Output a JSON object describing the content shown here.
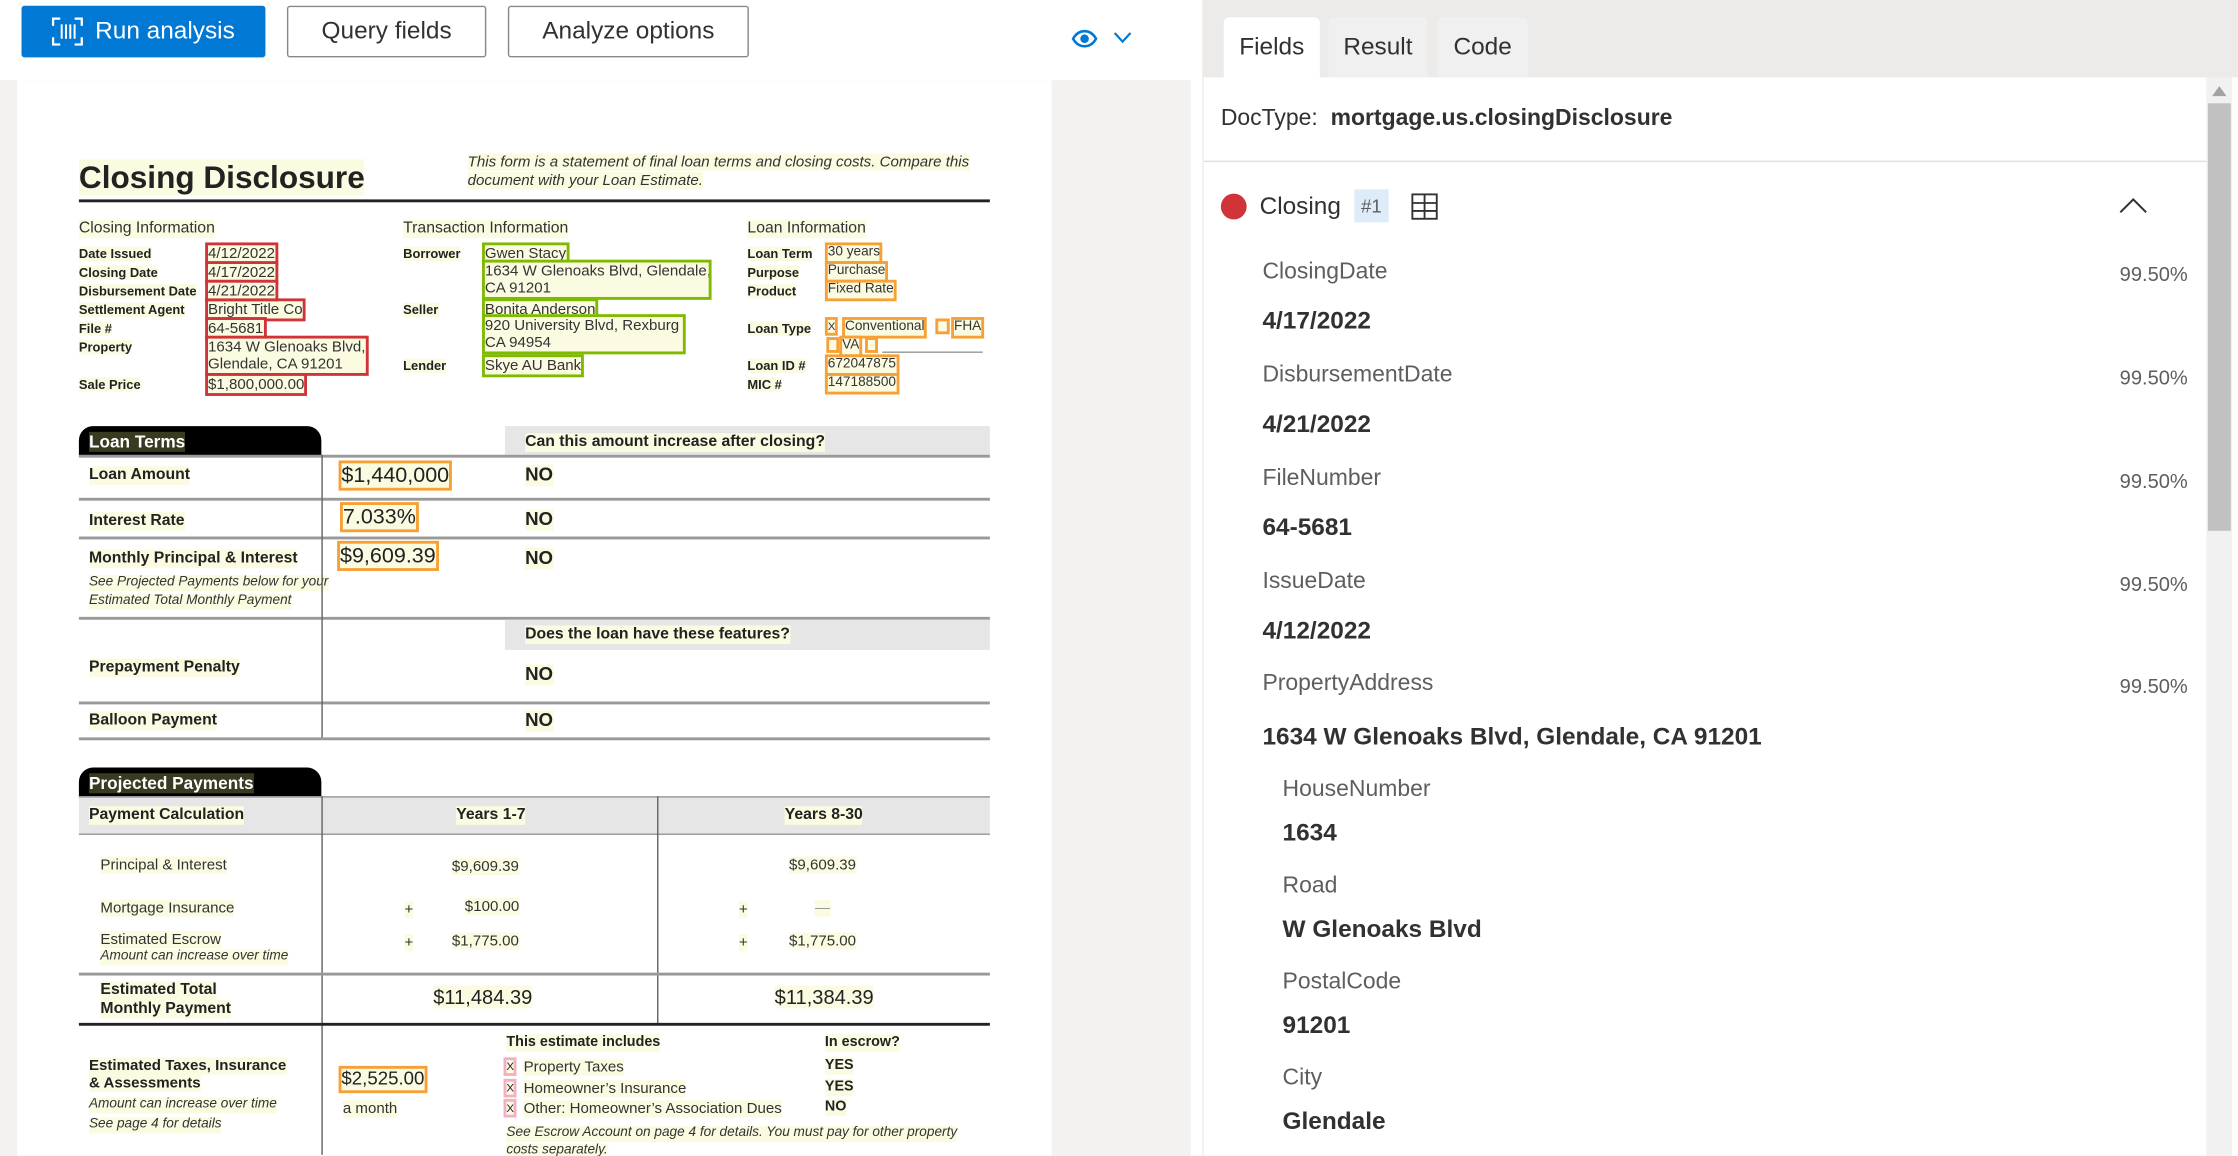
{
  "toolbar": {
    "run_label": "Run analysis",
    "query_label": "Query fields",
    "options_label": "Analyze options",
    "accent": "#0078d4"
  },
  "document": {
    "title": "Closing Disclosure",
    "note1": "This form is a statement of final loan terms and closing costs. Compare this",
    "note2": "document with your Loan Estimate.",
    "closing_info": {
      "header": "Closing Information",
      "rows": [
        {
          "label": "Date Issued",
          "value": "4/12/2022"
        },
        {
          "label": "Closing Date",
          "value": "4/17/2022"
        },
        {
          "label": "Disbursement Date",
          "value": "4/21/2022"
        },
        {
          "label": "Settlement Agent",
          "value": "Bright Title Co"
        },
        {
          "label": "File #",
          "value": "64-5681"
        },
        {
          "label": "Property",
          "value": "1634 W Glenoaks Blvd,",
          "value2": "Glendale, CA 91201"
        },
        {
          "label": "Sale Price",
          "value": "$1,800,000.00"
        }
      ]
    },
    "transaction_info": {
      "header": "Transaction Information",
      "borrower_label": "Borrower",
      "borrower": "Gwen Stacy",
      "borrower_addr1": "1634 W Glenoaks Blvd, Glendale,",
      "borrower_addr2": "CA 91201",
      "seller_label": "Seller",
      "seller": "Bonita Anderson",
      "seller_addr1": "920 University Blvd, Rexburg",
      "seller_addr2": "CA 94954",
      "lender_label": "Lender",
      "lender": "Skye AU Bank"
    },
    "loan_info": {
      "header": "Loan Information",
      "term_label": "Loan Term",
      "term": "30 years",
      "purpose_label": "Purpose",
      "purpose": "Purchase",
      "product_label": "Product",
      "product": "Fixed Rate",
      "type_label": "Loan Type",
      "type_conv": "Conventional",
      "type_fha": "FHA",
      "type_va": "VA",
      "check_x": "X",
      "id_label": "Loan ID #",
      "id": "672047875",
      "mic_label": "MIC #",
      "mic": "147188500"
    },
    "loan_terms": {
      "tab": "Loan Terms",
      "question1": "Can this amount increase after closing?",
      "question2": "Does the loan have these features?",
      "rows": [
        {
          "label": "Loan Amount",
          "value": "$1,440,000",
          "answer": "NO"
        },
        {
          "label": "Interest Rate",
          "value": "7.033%",
          "answer": "NO"
        },
        {
          "label": "Monthly Principal & Interest",
          "value": "$9,609.39",
          "answer": "NO",
          "note1": "See Projected Payments below for your",
          "note2": "Estimated Total Monthly Payment"
        },
        {
          "label": "Prepayment Penalty",
          "answer": "NO"
        },
        {
          "label": "Balloon Payment",
          "answer": "NO"
        }
      ]
    },
    "projected": {
      "tab": "Projected Payments",
      "col0": "Payment Calculation",
      "col1": "Years 1-7",
      "col2": "Years 8-30",
      "pi_label": "Principal & Interest",
      "pi1": "$9,609.39",
      "pi2": "$9,609.39",
      "mi_label": "Mortgage Insurance",
      "mi1": "$100.00",
      "mi2": "—",
      "plus": "+",
      "esc_label": "Estimated Escrow",
      "esc_note": "Amount can increase over time",
      "esc1": "$1,775.00",
      "esc2": "$1,775.00",
      "total_label1": "Estimated Total",
      "total_label2": "Monthly Payment",
      "total1": "$11,484.39",
      "total2": "$11,384.39",
      "tax_label1": "Estimated Taxes, Insurance",
      "tax_label2": "& Assessments",
      "tax_note1": "Amount can increase over time",
      "tax_note2": "See page 4 for details",
      "tax_value": "$2,525.00",
      "tax_period": "a month",
      "includes_header": "This estimate includes",
      "escrow_header": "In escrow?",
      "includes": [
        {
          "item": "Property Taxes",
          "escrow": "YES"
        },
        {
          "item": "Homeowner’s Insurance",
          "escrow": "YES"
        },
        {
          "item": "Other: Homeowner’s Association Dues",
          "escrow": "NO"
        }
      ],
      "footnote1": "See Escrow Account on page 4 for details. You must pay for other property",
      "footnote2": "costs separately."
    }
  },
  "panel": {
    "tabs": [
      "Fields",
      "Result",
      "Code"
    ],
    "doctype_label": "DocType:",
    "doctype": "mortgage.us.closingDisclosure",
    "group": {
      "name": "Closing",
      "badge": "#1",
      "color": "#d13438"
    },
    "fields": [
      {
        "name": "ClosingDate",
        "value": "4/17/2022",
        "confidence": "99.50%"
      },
      {
        "name": "DisbursementDate",
        "value": "4/21/2022",
        "confidence": "99.50%"
      },
      {
        "name": "FileNumber",
        "value": "64-5681",
        "confidence": "99.50%"
      },
      {
        "name": "IssueDate",
        "value": "4/12/2022",
        "confidence": "99.50%"
      },
      {
        "name": "PropertyAddress",
        "value": "1634 W Glenoaks Blvd, Glendale, CA 91201",
        "confidence": "99.50%"
      }
    ],
    "subfields": [
      {
        "name": "HouseNumber",
        "value": "1634"
      },
      {
        "name": "Road",
        "value": "W Glenoaks Blvd"
      },
      {
        "name": "PostalCode",
        "value": "91201"
      },
      {
        "name": "City",
        "value": "Glendale"
      }
    ]
  }
}
